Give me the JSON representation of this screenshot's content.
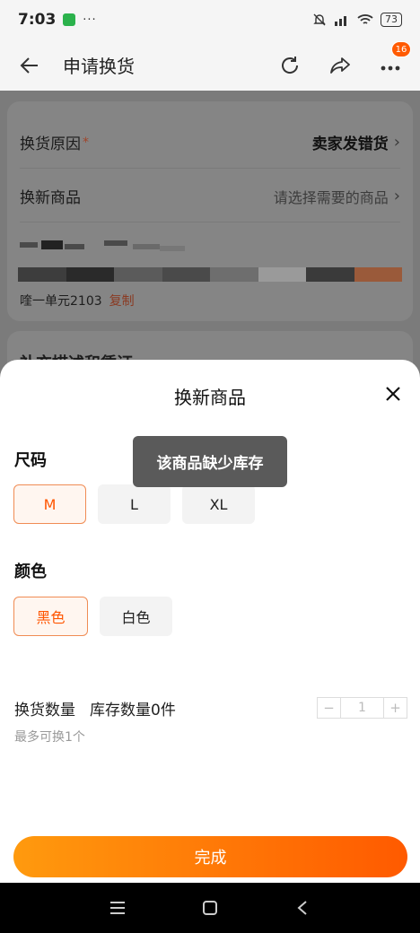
{
  "status_bar": {
    "time": "7:03",
    "dots": "···",
    "battery": "73"
  },
  "nav": {
    "back_icon": "back-arrow-icon",
    "title": "申请换货",
    "badge_count": "16"
  },
  "background": {
    "reason_label": "换货原因",
    "reason_required": "*",
    "reason_value": "卖家发错货",
    "product_label": "换新商品",
    "product_placeholder": "请选择需要的商品",
    "chevron": "›",
    "address_text": "喹一单元2103",
    "copy_label": "复制",
    "peek_text": "补充描述和凭证"
  },
  "sheet": {
    "title": "换新商品",
    "size_label": "尺码",
    "sizes": [
      "M",
      "L",
      "XL"
    ],
    "color_label": "颜色",
    "colors": [
      "黑色",
      "白色"
    ],
    "qty_label": "换货数量",
    "stock_text": "库存数量0件",
    "qty_hint": "最多可换1个",
    "stepper": {
      "minus": "−",
      "value": "1",
      "plus": "+"
    },
    "done_label": "完成"
  },
  "toast": {
    "text": "该商品缺少库存"
  }
}
